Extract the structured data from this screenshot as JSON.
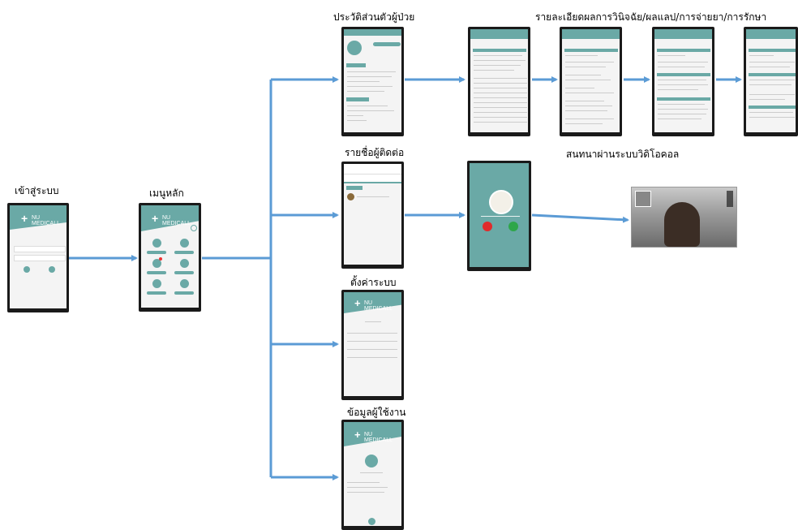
{
  "labels": {
    "login": "เข้าสู่ระบบ",
    "main_menu": "เมนูหลัก",
    "patient_history": "ประวัติส่วนตัวผู้ป่วย",
    "diagnosis_details": "รายละเอียดผลการวินิจฉัย/ผลแลป/การจ่ายยา/การรักษา",
    "contacts": "รายชื่อผู้ติดต่อ",
    "video_call": "สนทนาผ่านระบบวิดิโอคอล",
    "settings": "ตั้งค่าระบบ",
    "user_info": "ข้อมูลผู้ใช้งาน"
  },
  "app": {
    "brand": "NU MEDICALL"
  },
  "colors": {
    "teal": "#6aa9a6",
    "arrow": "#5b9bd5",
    "phone_frame": "#1a1a1a"
  }
}
